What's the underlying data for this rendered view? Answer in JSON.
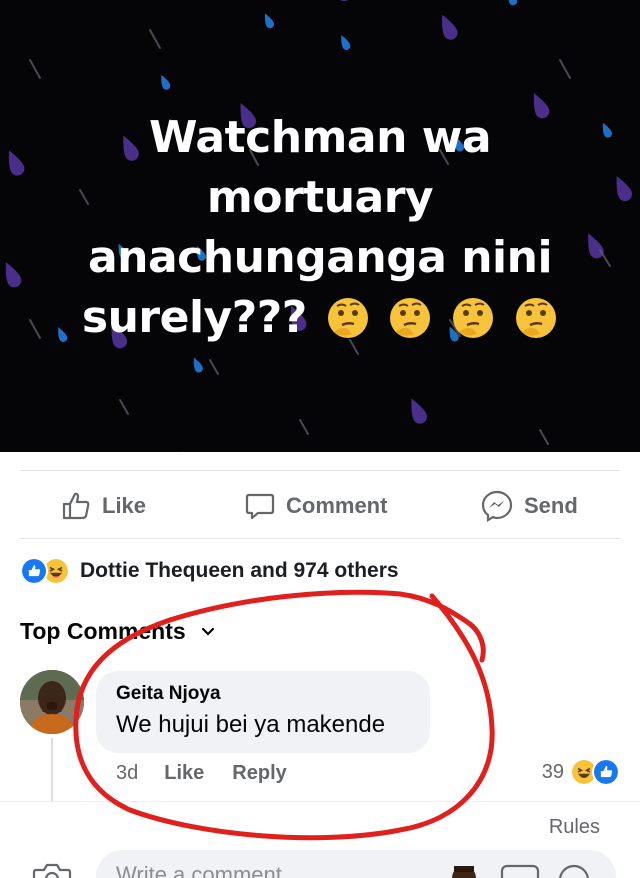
{
  "post": {
    "text": "Watchman wa mortuary anachunganga nini surely???",
    "emoji": "thinking-face"
  },
  "actions": {
    "like_label": "Like",
    "comment_label": "Comment",
    "send_label": "Send"
  },
  "reactions": {
    "summary": "Dottie Thequeen and 974 others",
    "icons": [
      "like-reaction-icon",
      "haha-reaction-icon"
    ]
  },
  "comments_header": {
    "label": "Top Comments"
  },
  "comment": {
    "author": "Geita Njoya",
    "text": "We hujui bei ya makende",
    "time": "3d",
    "like_label": "Like",
    "reply_label": "Reply",
    "reaction_count": "39"
  },
  "rules_label": "Rules",
  "compose": {
    "placeholder": "Write a comment..."
  },
  "colors": {
    "post_background": "#050508",
    "drop_purple": "#4a2f8a",
    "drop_blue": "#1f6fc4",
    "annotation_red": "#e0201c",
    "like_blue": "#1877f2",
    "haha_yellow": "#f7c33b"
  }
}
